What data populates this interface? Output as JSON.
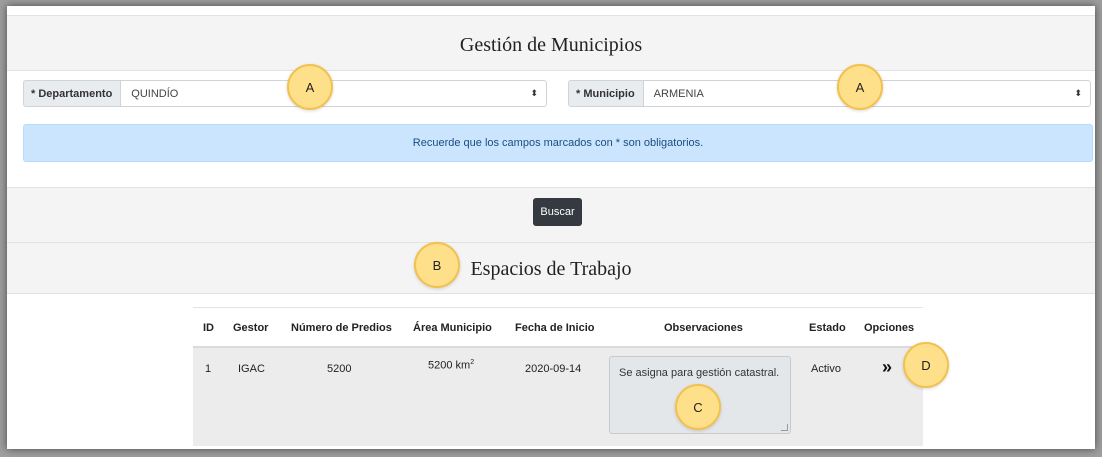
{
  "page": {
    "title": "Gestión de Municipios",
    "workspaces_title": "Espacios de Trabajo"
  },
  "filters": {
    "departamento_label": "* Departamento",
    "departamento_value": "QUINDÍO",
    "municipio_label": "* Municipio",
    "municipio_value": "ARMENIA"
  },
  "alert": {
    "text": "Recuerde que los campos marcados con * son obligatorios."
  },
  "search": {
    "label": "Buscar"
  },
  "table": {
    "headers": [
      "ID",
      "Gestor",
      "Número de Predios",
      "Área Municipio",
      "Fecha de Inicio",
      "Observaciones",
      "Estado",
      "Opciones"
    ],
    "rows": [
      {
        "id": "1",
        "gestor": "IGAC",
        "predios": "5200",
        "area": "5200 km",
        "area_sup": "2",
        "fecha": "2020-09-14",
        "observaciones": "Se asigna para gestión catastral.",
        "estado": "Activo",
        "opciones_icon": "double-chevron-right-icon",
        "opciones_glyph": "»"
      }
    ]
  },
  "annotations": {
    "a1": "A",
    "a2": "A",
    "b": "B",
    "c": "C",
    "d": "D"
  },
  "colors": {
    "marker_fill": "#ffe08a",
    "marker_border": "#f2c14e",
    "alert_bg": "#cce5ff",
    "button_bg": "#343a40"
  }
}
